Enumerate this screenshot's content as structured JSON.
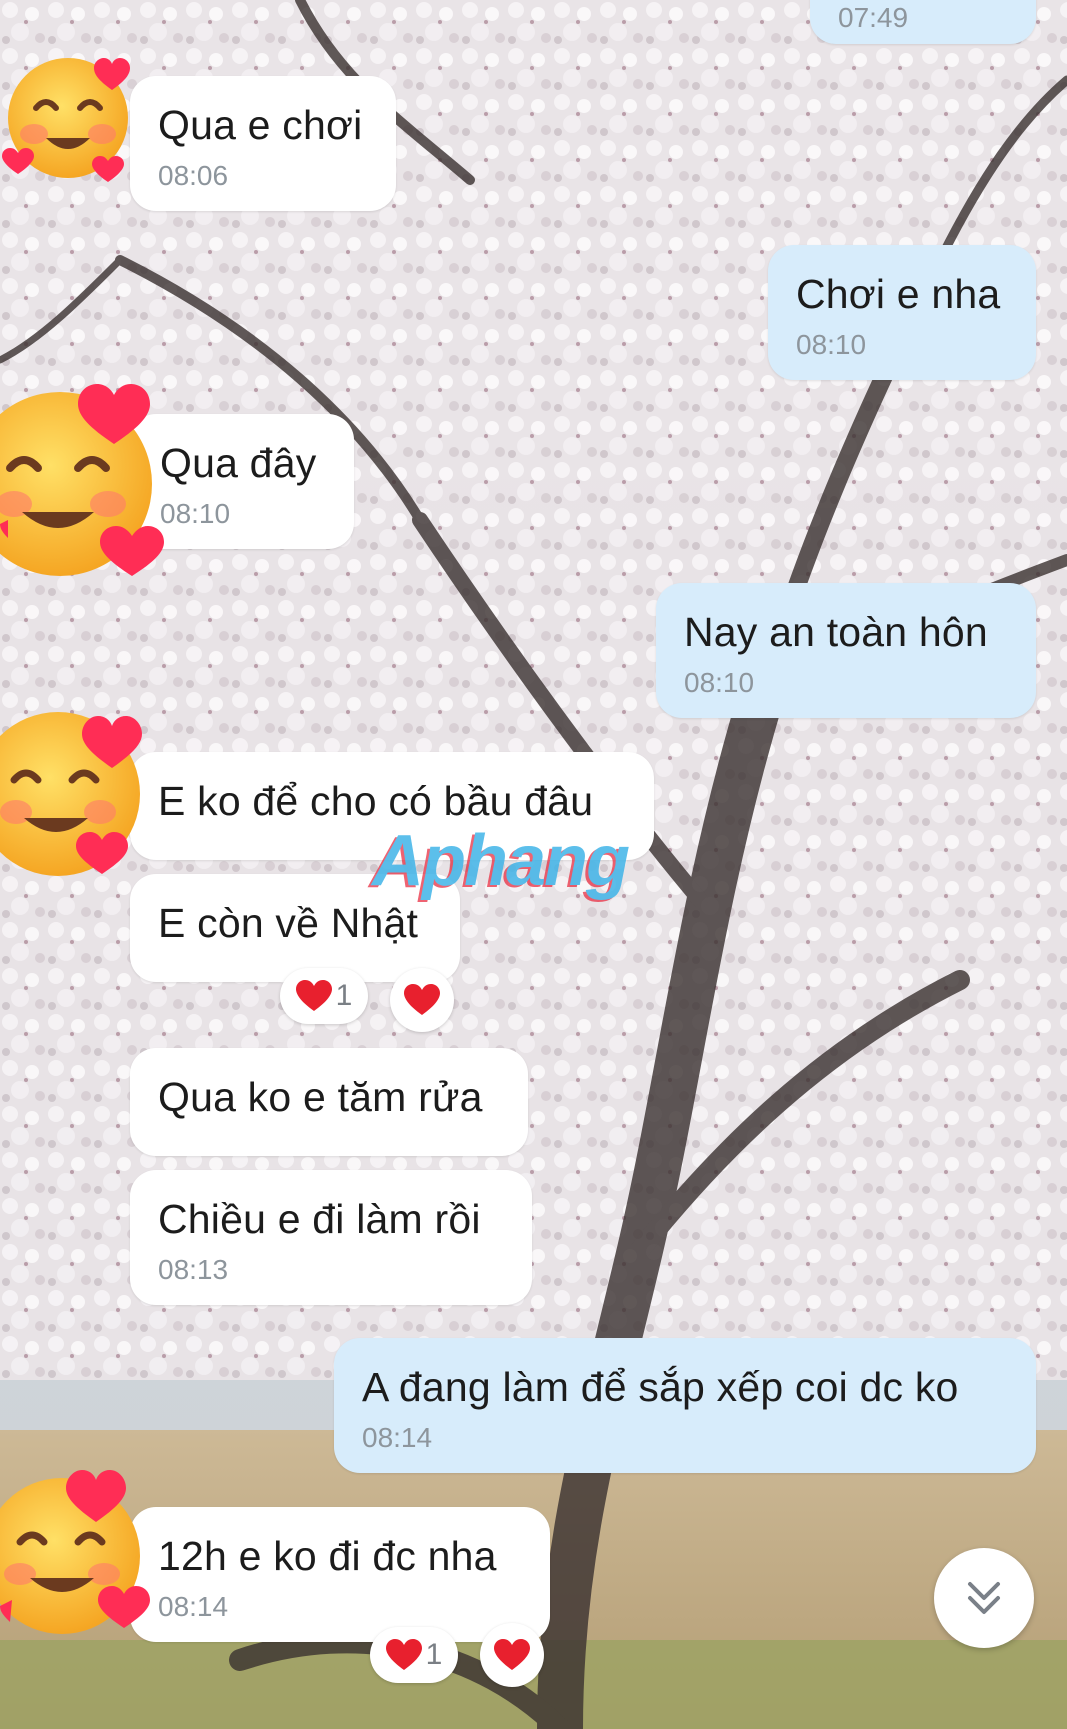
{
  "theme": {
    "incoming_bubble": "#ffffff",
    "outgoing_bubble": "#d7ecfb",
    "timestamp_color": "#8d959c",
    "reaction_color": "#e8202e"
  },
  "avatar": {
    "icon": "smiling-face-with-hearts-icon"
  },
  "messages": [
    {
      "direction": "out",
      "text": "",
      "time": "07:49"
    },
    {
      "direction": "in",
      "text": "Qua e chơi",
      "time": "08:06"
    },
    {
      "direction": "out",
      "text": "Chơi e nha",
      "time": "08:10"
    },
    {
      "direction": "in",
      "text": "Qua đây",
      "time": "08:10"
    },
    {
      "direction": "out",
      "text": "Nay an toàn hôn",
      "time": "08:10"
    },
    {
      "direction": "in",
      "text": "E ko để cho có bầu đâu"
    },
    {
      "direction": "in",
      "text": "E còn về Nhật",
      "reaction": {
        "icon": "heart-icon",
        "count": "1"
      }
    },
    {
      "direction": "in",
      "text": "Qua ko e tăm rửa"
    },
    {
      "direction": "in",
      "text": "Chiều e đi làm rồi",
      "time": "08:13"
    },
    {
      "direction": "out",
      "text": "A đang làm để sắp xếp coi dc ko",
      "time": "08:14"
    },
    {
      "direction": "in",
      "text": "12h e ko đi đc nha",
      "time": "08:14",
      "reaction": {
        "icon": "heart-icon",
        "count": "1"
      }
    }
  ],
  "watermark": "Aphang",
  "scroll_button": {
    "icon": "chevron-double-down-icon"
  }
}
